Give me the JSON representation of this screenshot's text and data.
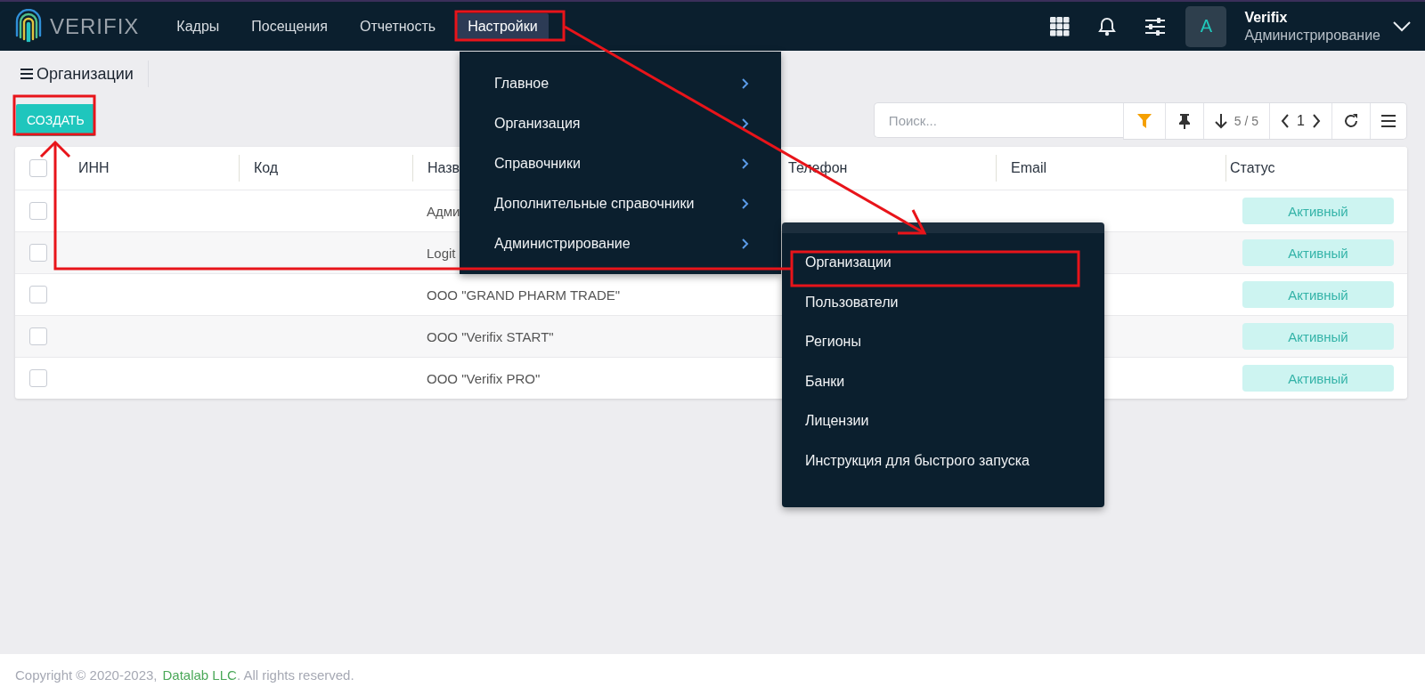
{
  "header": {
    "logo": "VERIFIX",
    "nav": [
      {
        "label": "Кадры",
        "selected": false
      },
      {
        "label": "Посещения",
        "selected": false
      },
      {
        "label": "Отчетность",
        "selected": false
      },
      {
        "label": "Настройки",
        "selected": true
      }
    ],
    "avatar": "A",
    "user": {
      "name": "Verifix",
      "role": "Администрирование"
    }
  },
  "page": {
    "title": "Организации",
    "create_button": "СОЗДАТЬ"
  },
  "toolbar": {
    "search": {
      "placeholder": "Поиск..."
    },
    "count": "5 / 5",
    "page": "1"
  },
  "table": {
    "select_all_checked": false,
    "columns": [
      "ИНН",
      "Код",
      "Назв",
      "Телефон",
      "Email",
      "Статус"
    ],
    "rows": [
      {
        "checked": false,
        "name": "Адми",
        "status": "Активный"
      },
      {
        "checked": false,
        "name": "Logit",
        "status": "Активный"
      },
      {
        "checked": false,
        "name": "ООО \"GRAND PHARM TRADE\"",
        "status": "Активный"
      },
      {
        "checked": false,
        "name": "ООО \"Verifix START\"",
        "status": "Активный"
      },
      {
        "checked": false,
        "name": "ООО \"Verifix PRO\"",
        "status": "Активный"
      }
    ]
  },
  "settings_menu": {
    "items": [
      "Главное",
      "Организация",
      "Справочники",
      "Дополнительные справочники",
      "Администрирование"
    ]
  },
  "admin_submenu": {
    "items": [
      "Организации",
      "Пользователи",
      "Регионы",
      "Банки",
      "Лицензии",
      "Инструкция для быстрого запуска"
    ]
  },
  "footer": {
    "text": "Copyright © 2020-2023,",
    "link": "Datalab LLC",
    "suffix": ". All rights reserved."
  }
}
